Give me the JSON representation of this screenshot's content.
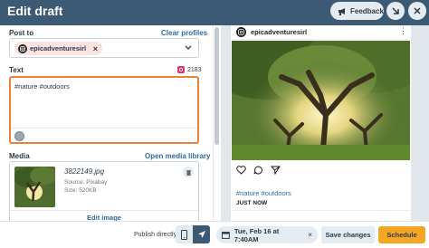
{
  "header": {
    "title": "Edit draft",
    "feedback_label": "Feedback"
  },
  "post_to": {
    "label": "Post to",
    "clear_label": "Clear profiles",
    "profile_name": "epicadventuresirl"
  },
  "text": {
    "label": "Text",
    "char_count": "2183",
    "content": "#nature #outdoors"
  },
  "media": {
    "label": "Media",
    "open_library_label": "Open media library",
    "filename": "3822149.jpg",
    "source": "Source: Pixabay",
    "size": "Size: 520KB",
    "edit_image_label": "Edit image"
  },
  "preview": {
    "username": "epicadventuresirl",
    "caption": "#nature #outdoors",
    "time_label": "JUST NOW"
  },
  "footer": {
    "publish_label": "Publish directly",
    "datetime": "Tue, Feb 16 at 7:40AM",
    "save_label": "Save changes",
    "schedule_label": "Schedule"
  },
  "colors": {
    "header_bg": "#3c5a73",
    "accent_orange": "#e8833a",
    "schedule_bg": "#f5a623",
    "link_blue": "#2e6da4"
  }
}
